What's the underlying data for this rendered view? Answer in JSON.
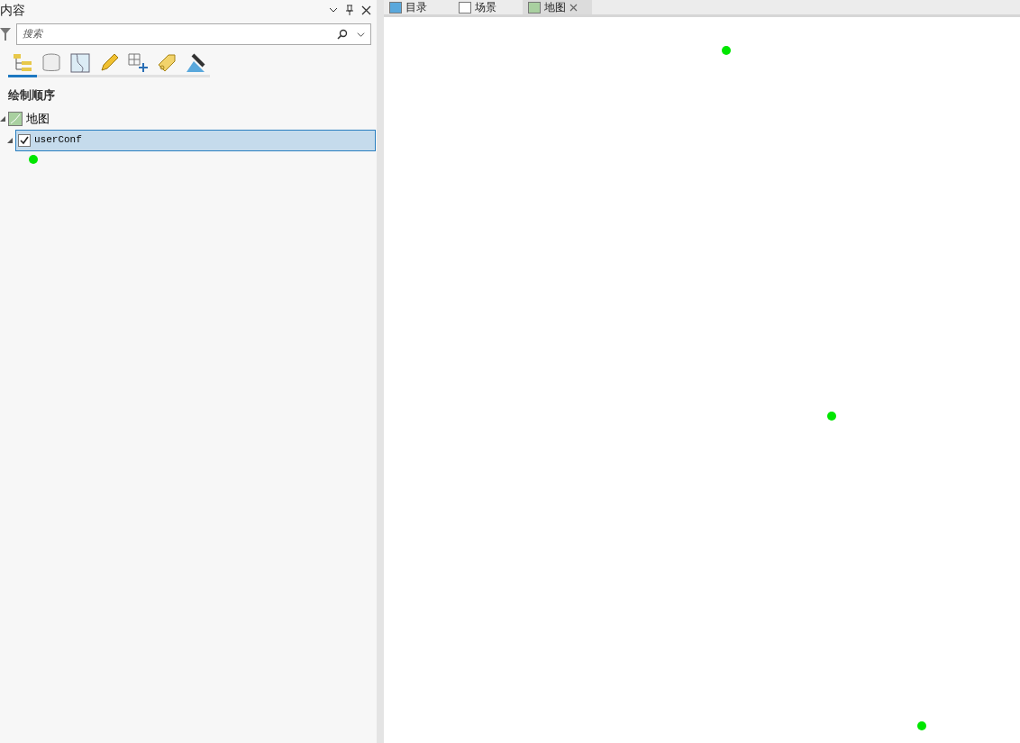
{
  "panel": {
    "title": "内容",
    "search": {
      "placeholder": "搜索"
    },
    "toolbar": [
      {
        "selected": true
      },
      {
        "selected": false
      },
      {
        "selected": false
      },
      {
        "selected": false
      },
      {
        "selected": false
      },
      {
        "selected": false
      },
      {
        "selected": false
      }
    ],
    "section_title": "绘制顺序",
    "tree": [
      {
        "label": "地图",
        "expanded": true,
        "children": [
          {
            "label": "userConf",
            "expanded": true,
            "checked": true,
            "selected": true
          }
        ]
      }
    ]
  },
  "tabs": [
    {
      "label": "目录",
      "selected": false
    },
    {
      "label": "场景",
      "selected": false
    },
    {
      "label": "地图",
      "selected": true
    }
  ]
}
